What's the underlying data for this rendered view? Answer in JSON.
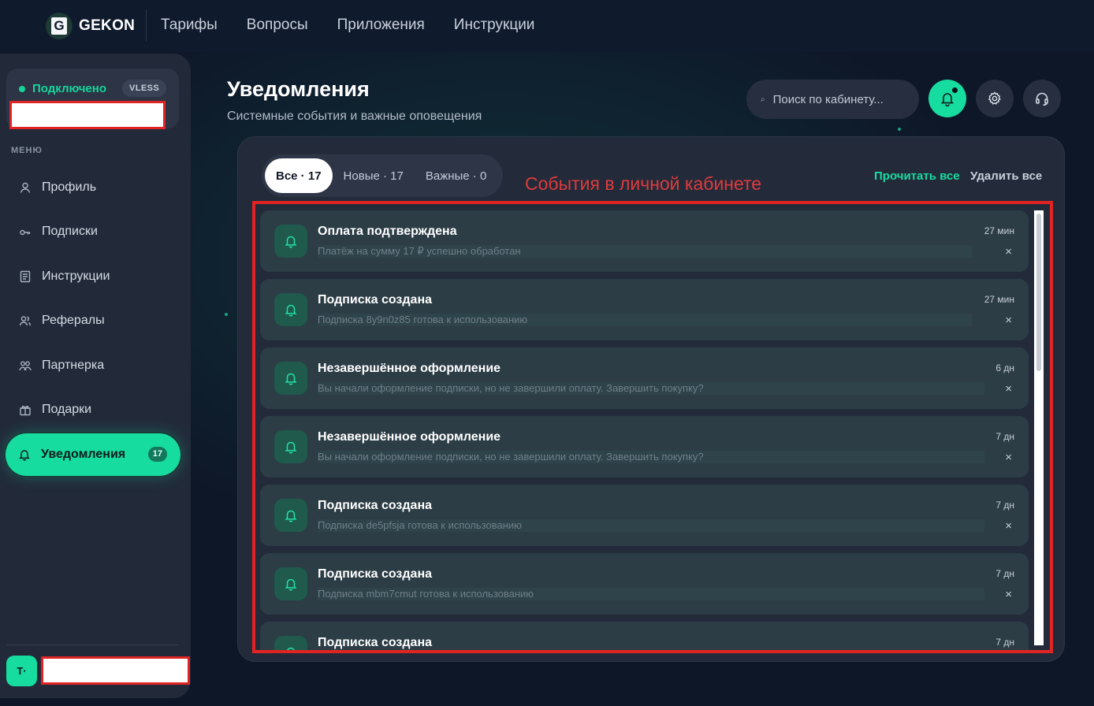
{
  "brand": {
    "logo_letter": "G",
    "name": "GEKON"
  },
  "topnav": [
    "Тарифы",
    "Вопросы",
    "Приложения",
    "Инструкции"
  ],
  "sidebar": {
    "connection": {
      "status": "Подключено",
      "protocol": "VLESS"
    },
    "menu_caption": "МЕНЮ",
    "items": [
      {
        "label": "Профиль",
        "icon": "user-icon"
      },
      {
        "label": "Подписки",
        "icon": "key-icon"
      },
      {
        "label": "Инструкции",
        "icon": "document-icon"
      },
      {
        "label": "Рефералы",
        "icon": "users-icon"
      },
      {
        "label": "Партнерка",
        "icon": "partners-icon"
      },
      {
        "label": "Подарки",
        "icon": "gift-icon"
      },
      {
        "label": "Уведомления",
        "icon": "bell-icon",
        "badge": "17",
        "active": true
      }
    ],
    "user_initials": "T·"
  },
  "header": {
    "title": "Уведомления",
    "subtitle": "Системные события и важные оповещения",
    "search_placeholder": "Поиск по кабинету..."
  },
  "tabs": [
    {
      "label": "Все · 17",
      "active": true
    },
    {
      "label": "Новые · 17"
    },
    {
      "label": "Важные · 0"
    }
  ],
  "annotation": "События в личной кабинете",
  "actions": {
    "read_all": "Прочитать все",
    "delete_all": "Удалить все"
  },
  "notifications": [
    {
      "title": "Оплата подтверждена",
      "body": "Платёж на сумму 17 ₽ успешно обработан",
      "time": "27 мин"
    },
    {
      "title": "Подписка создана",
      "body": "Подписка 8y9n0z85 готова к использованию",
      "time": "27 мин"
    },
    {
      "title": "Незавершённое оформление",
      "body": "Вы начали оформление подписки, но не завершили оплату. Завершить покупку?",
      "time": "6 дн"
    },
    {
      "title": "Незавершённое оформление",
      "body": "Вы начали оформление подписки, но не завершили оплату. Завершить покупку?",
      "time": "7 дн"
    },
    {
      "title": "Подписка создана",
      "body": "Подписка de5pfsja готова к использованию",
      "time": "7 дн"
    },
    {
      "title": "Подписка создана",
      "body": "Подписка mbm7cmut готова к использованию",
      "time": "7 дн"
    },
    {
      "title": "Подписка создана",
      "body": "",
      "time": "7 дн"
    }
  ],
  "close_glyph": "×",
  "colors": {
    "accent": "#17dc9f",
    "annotation_red": "#e02424"
  }
}
